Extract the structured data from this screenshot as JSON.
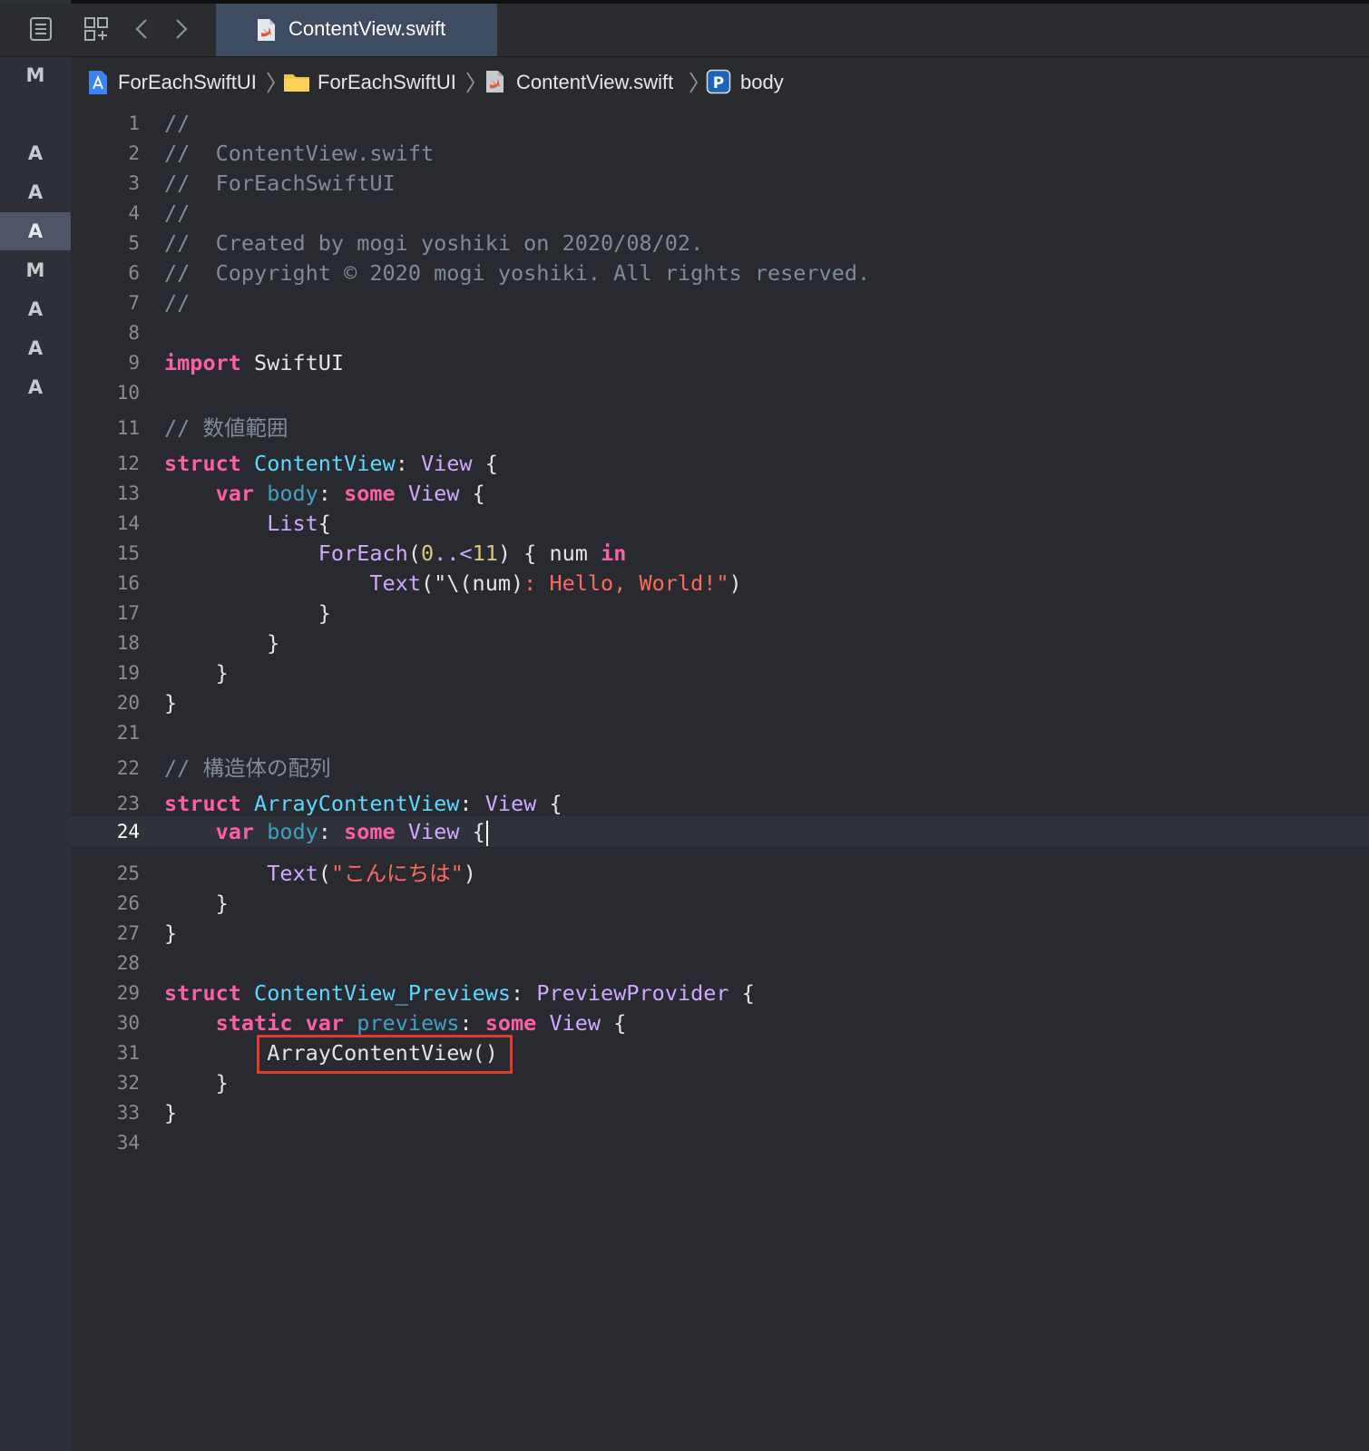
{
  "tab": {
    "title": "ContentView.swift"
  },
  "jumpbar": {
    "crumbs": [
      "ForEachSwiftUI",
      "ForEachSwiftUI",
      "ContentView.swift",
      "body"
    ],
    "symbol_letter": "P"
  },
  "source_control": {
    "top_badge": "M",
    "badges": [
      "A",
      "A",
      "A",
      "M",
      "A",
      "A",
      "A"
    ]
  },
  "editor": {
    "current_line": 24,
    "lines": [
      {
        "n": "1",
        "t": [
          {
            "c": "cmt",
            "s": "//"
          }
        ]
      },
      {
        "n": "2",
        "t": [
          {
            "c": "cmt",
            "s": "//  ContentView.swift"
          }
        ]
      },
      {
        "n": "3",
        "t": [
          {
            "c": "cmt",
            "s": "//  ForEachSwiftUI"
          }
        ]
      },
      {
        "n": "4",
        "t": [
          {
            "c": "cmt",
            "s": "//"
          }
        ]
      },
      {
        "n": "5",
        "t": [
          {
            "c": "cmt",
            "s": "//  Created by mogi yoshiki on 2020/08/02."
          }
        ]
      },
      {
        "n": "6",
        "t": [
          {
            "c": "cmt",
            "s": "//  Copyright © 2020 mogi yoshiki. All rights reserved."
          }
        ]
      },
      {
        "n": "7",
        "t": [
          {
            "c": "cmt",
            "s": "//"
          }
        ]
      },
      {
        "n": "8",
        "t": []
      },
      {
        "n": "9",
        "t": [
          {
            "c": "kw",
            "s": "import"
          },
          {
            "c": "plain",
            "s": " SwiftUI"
          }
        ]
      },
      {
        "n": "10",
        "t": []
      },
      {
        "n": "11",
        "t": [
          {
            "c": "cmt",
            "s": "// 数値範囲"
          }
        ]
      },
      {
        "n": "12",
        "t": [
          {
            "c": "kw",
            "s": "struct"
          },
          {
            "c": "plain",
            "s": " "
          },
          {
            "c": "tdecl",
            "s": "ContentView"
          },
          {
            "c": "plain",
            "s": ": "
          },
          {
            "c": "ttype",
            "s": "View"
          },
          {
            "c": "plain",
            "s": " {"
          }
        ]
      },
      {
        "n": "13",
        "t": [
          {
            "c": "plain",
            "s": "    "
          },
          {
            "c": "kw",
            "s": "var"
          },
          {
            "c": "plain",
            "s": " "
          },
          {
            "c": "prop",
            "s": "body"
          },
          {
            "c": "plain",
            "s": ": "
          },
          {
            "c": "kw",
            "s": "some"
          },
          {
            "c": "plain",
            "s": " "
          },
          {
            "c": "ttype",
            "s": "View"
          },
          {
            "c": "plain",
            "s": " {"
          }
        ]
      },
      {
        "n": "14",
        "t": [
          {
            "c": "plain",
            "s": "        "
          },
          {
            "c": "ttype",
            "s": "List"
          },
          {
            "c": "plain",
            "s": "{"
          }
        ]
      },
      {
        "n": "15",
        "t": [
          {
            "c": "plain",
            "s": "            "
          },
          {
            "c": "ttype",
            "s": "ForEach"
          },
          {
            "c": "plain",
            "s": "("
          },
          {
            "c": "num",
            "s": "0"
          },
          {
            "c": "ttype",
            "s": "..<"
          },
          {
            "c": "num",
            "s": "11"
          },
          {
            "c": "plain",
            "s": ") { num "
          },
          {
            "c": "kw",
            "s": "in"
          }
        ]
      },
      {
        "n": "16",
        "t": [
          {
            "c": "plain",
            "s": "                "
          },
          {
            "c": "ttype",
            "s": "Text"
          },
          {
            "c": "plain",
            "s": "(\""
          },
          {
            "c": "plain",
            "s": "\\(num)"
          },
          {
            "c": "str",
            "s": ": Hello, World!\""
          },
          {
            "c": "plain",
            "s": ")"
          }
        ]
      },
      {
        "n": "17",
        "t": [
          {
            "c": "plain",
            "s": "            }"
          }
        ]
      },
      {
        "n": "18",
        "t": [
          {
            "c": "plain",
            "s": "        }"
          }
        ]
      },
      {
        "n": "19",
        "t": [
          {
            "c": "plain",
            "s": "    }"
          }
        ]
      },
      {
        "n": "20",
        "t": [
          {
            "c": "plain",
            "s": "}"
          }
        ]
      },
      {
        "n": "21",
        "t": []
      },
      {
        "n": "22",
        "t": [
          {
            "c": "cmt",
            "s": "// 構造体の配列"
          }
        ]
      },
      {
        "n": "23",
        "t": [
          {
            "c": "kw",
            "s": "struct"
          },
          {
            "c": "plain",
            "s": " "
          },
          {
            "c": "tdecl",
            "s": "ArrayContentView"
          },
          {
            "c": "plain",
            "s": ": "
          },
          {
            "c": "ttype",
            "s": "View"
          },
          {
            "c": "plain",
            "s": " {"
          }
        ]
      },
      {
        "n": "24",
        "t": [
          {
            "c": "plain",
            "s": "    "
          },
          {
            "c": "kw",
            "s": "var"
          },
          {
            "c": "plain",
            "s": " "
          },
          {
            "c": "prop",
            "s": "body"
          },
          {
            "c": "plain",
            "s": ": "
          },
          {
            "c": "kw",
            "s": "some"
          },
          {
            "c": "plain",
            "s": " "
          },
          {
            "c": "ttype",
            "s": "View"
          },
          {
            "c": "plain",
            "s": " {"
          }
        ]
      },
      {
        "n": "25",
        "t": [
          {
            "c": "plain",
            "s": "        "
          },
          {
            "c": "ttype",
            "s": "Text"
          },
          {
            "c": "plain",
            "s": "("
          },
          {
            "c": "str",
            "s": "\"こんにちは\""
          },
          {
            "c": "plain",
            "s": ")"
          }
        ]
      },
      {
        "n": "26",
        "t": [
          {
            "c": "plain",
            "s": "    }"
          }
        ]
      },
      {
        "n": "27",
        "t": [
          {
            "c": "plain",
            "s": "}"
          }
        ]
      },
      {
        "n": "28",
        "t": []
      },
      {
        "n": "29",
        "t": [
          {
            "c": "kw",
            "s": "struct"
          },
          {
            "c": "plain",
            "s": " "
          },
          {
            "c": "tdecl",
            "s": "ContentView_Previews"
          },
          {
            "c": "plain",
            "s": ": "
          },
          {
            "c": "ttype",
            "s": "PreviewProvider"
          },
          {
            "c": "plain",
            "s": " {"
          }
        ]
      },
      {
        "n": "30",
        "t": [
          {
            "c": "plain",
            "s": "    "
          },
          {
            "c": "kw",
            "s": "static"
          },
          {
            "c": "plain",
            "s": " "
          },
          {
            "c": "kw",
            "s": "var"
          },
          {
            "c": "plain",
            "s": " "
          },
          {
            "c": "prop",
            "s": "previews"
          },
          {
            "c": "plain",
            "s": ": "
          },
          {
            "c": "kw",
            "s": "some"
          },
          {
            "c": "plain",
            "s": " "
          },
          {
            "c": "ttype",
            "s": "View"
          },
          {
            "c": "plain",
            "s": " {"
          }
        ]
      },
      {
        "n": "31",
        "t": [
          {
            "c": "plain",
            "s": "        "
          },
          {
            "c": "plain",
            "s": "ArrayContentView()"
          }
        ]
      },
      {
        "n": "32",
        "t": [
          {
            "c": "plain",
            "s": "    }"
          }
        ]
      },
      {
        "n": "33",
        "t": [
          {
            "c": "plain",
            "s": "}"
          }
        ]
      },
      {
        "n": "34",
        "t": []
      }
    ]
  },
  "colors": {
    "background": "#292a30",
    "keyword": "#fc5fa3",
    "type_declaration": "#5dd8ff",
    "string": "#fc6a5d",
    "comment": "#7f8c98",
    "highlight_box": "#e23b2a"
  }
}
